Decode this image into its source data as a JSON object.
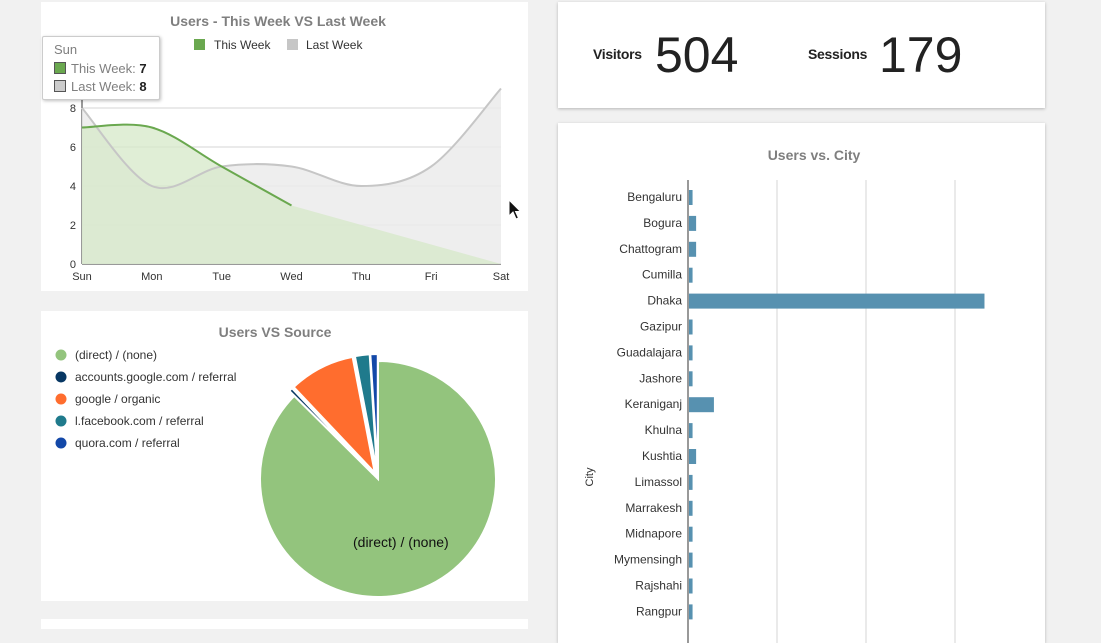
{
  "colors": {
    "this_week": "#6aa84f",
    "this_week_fill": "#d5e8c8",
    "last_week": "#c6c6c6",
    "last_week_fill": "#ebebeb",
    "city_bar": "#5791b0",
    "pie": [
      "#93c47d",
      "#073763",
      "#ff6d2e",
      "#1f7a8c",
      "#1348a8"
    ]
  },
  "kpi": {
    "visitors_label": "Visitors",
    "visitors_value": "504",
    "sessions_label": "Sessions",
    "sessions_value": "179"
  },
  "tooltip": {
    "title": "Sun",
    "this_week_label": "This Week",
    "this_week_value": "7",
    "last_week_label": "Last Week",
    "last_week_value": "8"
  },
  "chart_data": [
    {
      "type": "area",
      "title": "Users - This Week VS Last Week",
      "categories": [
        "Sun",
        "Mon",
        "Tue",
        "Wed",
        "Thu",
        "Fri",
        "Sat"
      ],
      "series": [
        {
          "name": "This Week",
          "values": [
            7,
            7,
            5,
            3,
            null,
            null,
            null
          ]
        },
        {
          "name": "Last Week",
          "values": [
            8,
            4,
            5,
            5,
            4,
            5,
            9
          ]
        }
      ],
      "ylim": [
        0,
        10
      ],
      "yticks": [
        0,
        2,
        4,
        6,
        8
      ],
      "grid": true,
      "legend": "top"
    },
    {
      "type": "pie",
      "title": "Users VS Source",
      "labels": [
        "(direct) / (none)",
        "accounts.google.com / referral",
        "google / organic",
        "l.facebook.com / referral",
        "quora.com / referral"
      ],
      "values": [
        87,
        0.5,
        9,
        2,
        1
      ],
      "slice_label": "(direct) / (none)",
      "legend": "left"
    },
    {
      "type": "bar",
      "orientation": "horizontal",
      "title": "Users vs. City",
      "ylabel": "City",
      "categories": [
        "Bengaluru",
        "Bogura",
        "Chattogram",
        "Cumilla",
        "Dhaka",
        "Gazipur",
        "Guadalajara",
        "Jashore",
        "Keraniganj",
        "Khulna",
        "Kushtia",
        "Limassol",
        "Marrakesh",
        "Midnapore",
        "Mymensingh",
        "Rajshahi",
        "Rangpur"
      ],
      "values": [
        1,
        2,
        2,
        1,
        83,
        1,
        1,
        1,
        7,
        1,
        2,
        1,
        1,
        1,
        1,
        1,
        1
      ],
      "xlim": [
        0,
        100
      ],
      "grid": true
    }
  ]
}
